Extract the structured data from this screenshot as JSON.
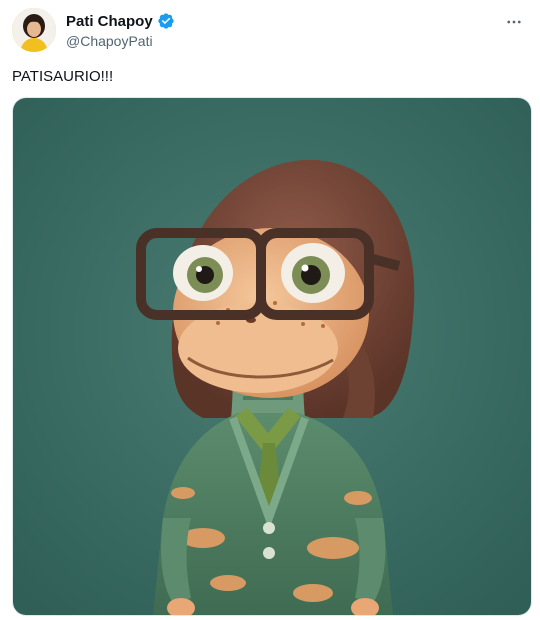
{
  "tweet": {
    "author": {
      "display_name": "Pati Chapoy",
      "handle": "@ChapoyPati",
      "verified": true,
      "avatar_icon": "profile-photo"
    },
    "text": "PATISAURIO!!!",
    "more_icon": "more-horizontal-icon",
    "media": {
      "kind": "image",
      "subject": "cartoon-dinosaur-with-glasses",
      "background_color": "#3b6d63"
    }
  },
  "colors": {
    "verified": "#1d9bf0",
    "handle": "#536471",
    "text": "#0f1419"
  }
}
